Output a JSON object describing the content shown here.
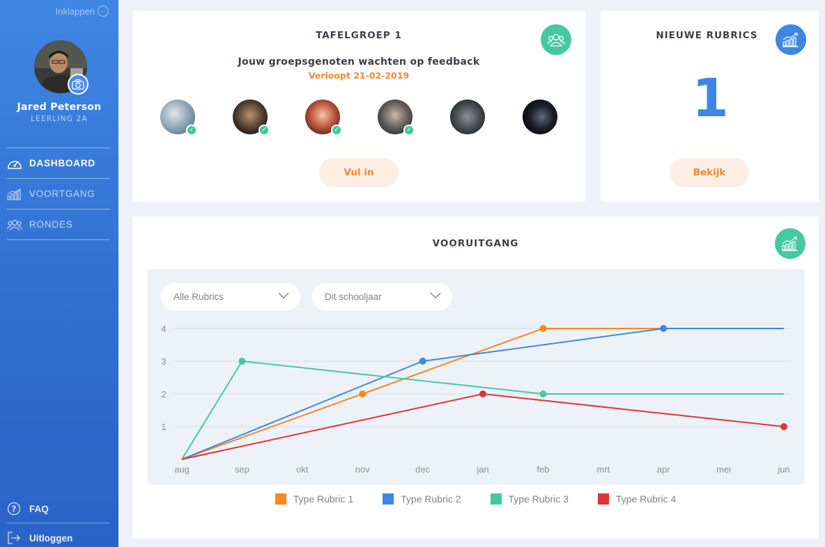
{
  "sidebar": {
    "collapse_label": "Inklappen",
    "user_name": "Jared Peterson",
    "user_class": "LEERLING 2A",
    "nav": [
      {
        "label": "DASHBOARD",
        "icon": "speedometer-icon",
        "active": true
      },
      {
        "label": "VOORTGANG",
        "icon": "bar-chart-icon",
        "active": false
      },
      {
        "label": "RONDES",
        "icon": "group-icon",
        "active": false
      }
    ],
    "faq_label": "FAQ",
    "logout_label": "Uitloggen"
  },
  "group_card": {
    "title": "TAFELGROEP 1",
    "message": "Jouw groepsgenoten wachten op feedback",
    "deadline": "Verloopt 21-02-2019",
    "button_label": "Vul in",
    "members": [
      {
        "done": true
      },
      {
        "done": true
      },
      {
        "done": true
      },
      {
        "done": true
      },
      {
        "done": false
      },
      {
        "done": false
      }
    ]
  },
  "rubrics_card": {
    "title": "NIEUWE RUBRICS",
    "count": "1",
    "button_label": "Bekijk"
  },
  "progress_card": {
    "title": "VOORUITGANG",
    "filter_rubric": "Alle Rubrics",
    "filter_period": "Dit schooljaar"
  },
  "colors": {
    "accent_blue": "#3f86e4",
    "accent_orange": "#f18a2a",
    "accent_teal": "#45c9a0",
    "accent_red": "#e03434"
  },
  "chart_data": {
    "type": "line",
    "categories": [
      "aug",
      "sep",
      "okt",
      "nov",
      "dec",
      "jan",
      "feb",
      "mrt",
      "apr",
      "mei",
      "jun"
    ],
    "ylim": [
      0,
      4
    ],
    "yticks": [
      1,
      2,
      3,
      4
    ],
    "grid": true,
    "legend_position": "bottom",
    "series": [
      {
        "name": "Type Rubric 1",
        "color": "#f7891f",
        "points": [
          [
            "aug",
            0
          ],
          [
            "nov",
            2
          ],
          [
            "feb",
            4
          ],
          [
            "apr",
            4
          ]
        ],
        "markers": [
          "nov",
          "feb"
        ]
      },
      {
        "name": "Type Rubric 2",
        "color": "#3f86e4",
        "points": [
          [
            "aug",
            0
          ],
          [
            "dec",
            3
          ],
          [
            "apr",
            4
          ],
          [
            "jun",
            4
          ]
        ],
        "markers": [
          "dec",
          "apr"
        ]
      },
      {
        "name": "Type Rubric 3",
        "color": "#45c9a0",
        "points": [
          [
            "aug",
            0
          ],
          [
            "sep",
            3
          ],
          [
            "feb",
            2
          ],
          [
            "jun",
            2
          ]
        ],
        "markers": [
          "sep",
          "feb"
        ]
      },
      {
        "name": "Type Rubric 4",
        "color": "#e03434",
        "points": [
          [
            "aug",
            0
          ],
          [
            "jan",
            2
          ],
          [
            "jun",
            1
          ]
        ],
        "markers": [
          "jan",
          "jun"
        ]
      }
    ]
  }
}
